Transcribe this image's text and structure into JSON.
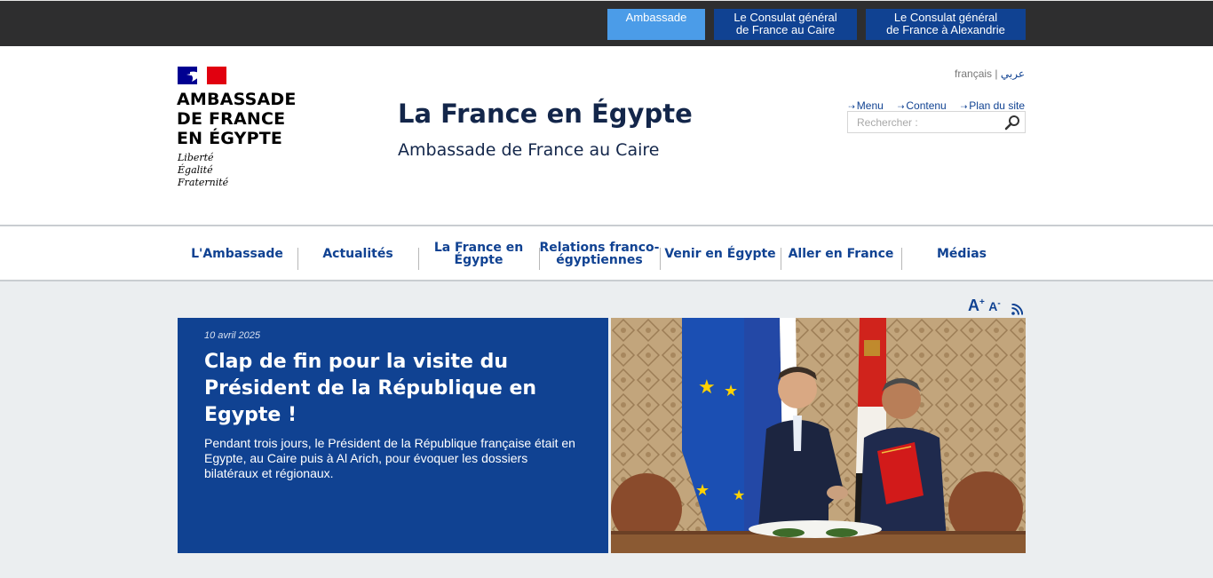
{
  "topbar": {
    "ambassade": "Ambassade",
    "consulat_caire_line1": "Le Consulat général",
    "consulat_caire_line2": "de France au Caire",
    "consulat_alex_line1": "Le Consulat général",
    "consulat_alex_line2": "de France à Alexandrie"
  },
  "logo": {
    "line1": "AMBASSADE",
    "line2": "DE FRANCE",
    "line3": "EN ÉGYPTE",
    "motto1": "Liberté",
    "motto2": "Égalité",
    "motto3": "Fraternité"
  },
  "header": {
    "title": "La France en Égypte",
    "subtitle": "Ambassade de France au Caire"
  },
  "lang": {
    "current": "français",
    "separator": "|",
    "alternate": "عربي"
  },
  "quicklinks": [
    "Menu",
    "Contenu",
    "Plan du site"
  ],
  "search": {
    "placeholder": "Rechercher :"
  },
  "nav": {
    "items": [
      "L'Ambassade",
      "Actualités",
      "La France en Égypte",
      "Relations franco-égyptiennes",
      "Venir en Égypte",
      "Aller en France",
      "Médias"
    ]
  },
  "tools": {
    "increase": "A",
    "decrease": "A",
    "plus": "+",
    "minus": "-",
    "rss_icon": "rss-icon"
  },
  "feature": {
    "date": "10 avril 2025",
    "headline": "Clap de fin pour la visite du Président de la République en Egypte !",
    "summary": "Pendant trois jours, le Président de la République française était en Egypte, au Caire puis à Al Arich, pour évoquer les dossiers bilatéraux et régionaux."
  },
  "colors": {
    "topbar_bg": "#2e2e2f",
    "ambassade_btn": "#4b9ce8",
    "brand_blue": "#104292",
    "content_bg": "#ebeef0"
  }
}
